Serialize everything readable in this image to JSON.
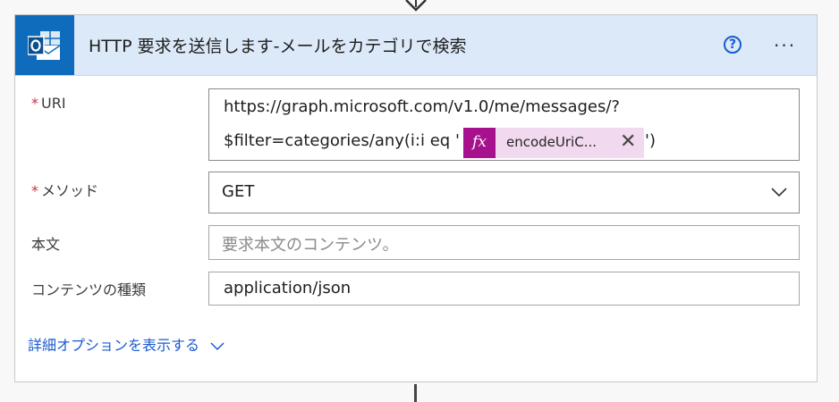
{
  "card": {
    "title": "HTTP 要求を送信します-メールをカテゴリで検索",
    "app_icon": "outlook-icon",
    "help_icon": "help-icon",
    "help_glyph": "?",
    "more_icon": "more-icon",
    "more_glyph": "···"
  },
  "fields": {
    "uri": {
      "required_mark": "*",
      "label": "URI",
      "line1": "https://graph.microsoft.com/v1.0/me/messages/?",
      "line2_prefix": "$filter=categories/any(i:i eq '",
      "token_label": "encodeUriC...",
      "token_icon_glyph": "fx",
      "token_close_glyph": "✕",
      "line2_suffix": "')"
    },
    "method": {
      "required_mark": "*",
      "label": "メソッド",
      "value": "GET"
    },
    "body": {
      "label": "本文",
      "placeholder": "要求本文のコンテンツ。"
    },
    "content_type": {
      "label": "コンテンツの種類",
      "value": "application/json"
    }
  },
  "advanced_options": {
    "label": "詳細オプションを表示する"
  },
  "colors": {
    "header_bg": "#dce9f8",
    "outlook_blue": "#0f6cbd",
    "expression_token": "#a7118e",
    "link": "#1a5bd1",
    "required": "#c4314b"
  }
}
